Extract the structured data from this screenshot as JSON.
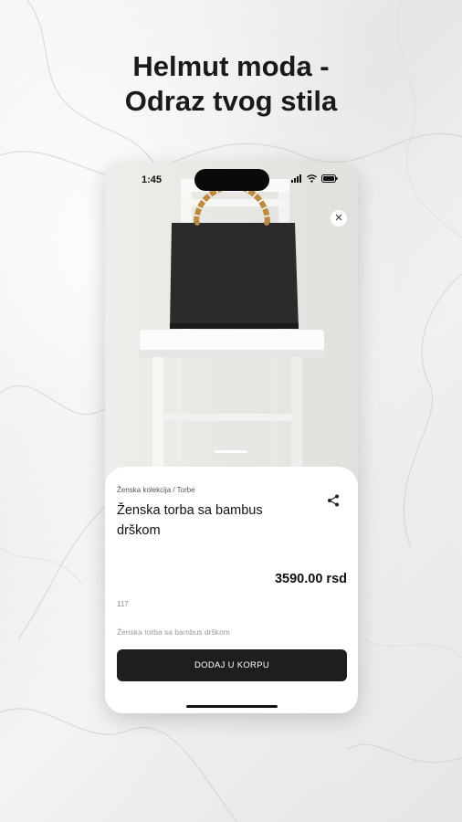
{
  "headline": {
    "line1": "Helmut moda -",
    "line2": "Odraz tvog stila"
  },
  "status_bar": {
    "time": "1:45",
    "icons": [
      "signal-icon",
      "wifi-icon",
      "battery-icon"
    ]
  },
  "product": {
    "image_icon": "handbag-photo",
    "breadcrumb": "Ženska kolekcija / Torbe",
    "title": "Ženska torba sa bambus drškom",
    "price": "3590.00 rsd",
    "code": "117",
    "description": "Ženska torba sa bambus drškom",
    "add_to_cart_label": "DODAJ U KORPU"
  },
  "icons": {
    "close": "close-icon",
    "share": "share-icon"
  },
  "colors": {
    "button_bg": "#1e1e1e",
    "sheet_bg": "#ffffff",
    "text": "#111111"
  }
}
